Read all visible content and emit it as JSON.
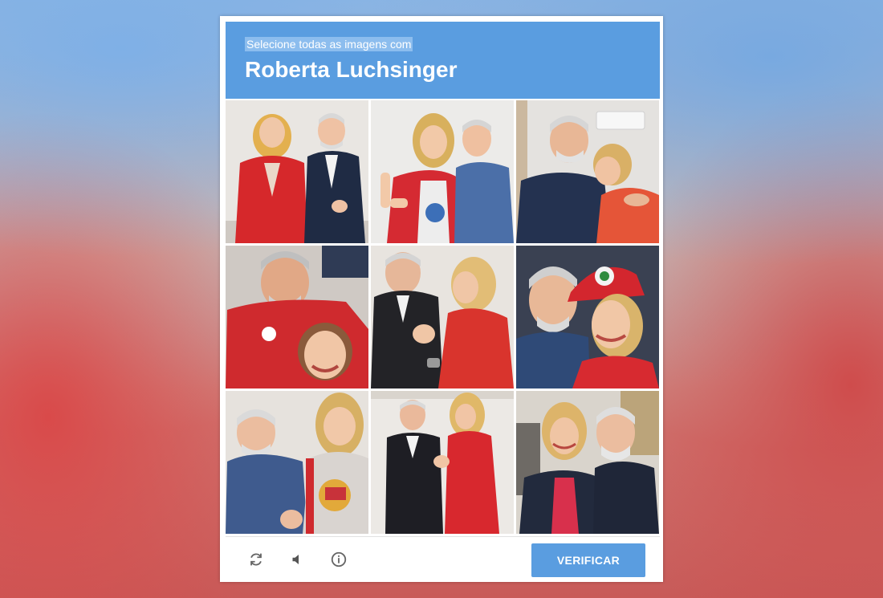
{
  "captcha": {
    "prompt": "Selecione todas as imagens com",
    "target": "Roberta Luchsinger",
    "accent_color": "#5a9de0",
    "tiles": [
      {
        "row": 1,
        "col": 1
      },
      {
        "row": 1,
        "col": 2
      },
      {
        "row": 1,
        "col": 3
      },
      {
        "row": 2,
        "col": 1
      },
      {
        "row": 2,
        "col": 2
      },
      {
        "row": 2,
        "col": 3
      },
      {
        "row": 3,
        "col": 1
      },
      {
        "row": 3,
        "col": 2
      },
      {
        "row": 3,
        "col": 3
      }
    ],
    "footer": {
      "reload_icon": "reload-icon",
      "audio_icon": "audio-icon",
      "info_icon": "info-icon",
      "verify_label": "VERIFICAR"
    }
  }
}
